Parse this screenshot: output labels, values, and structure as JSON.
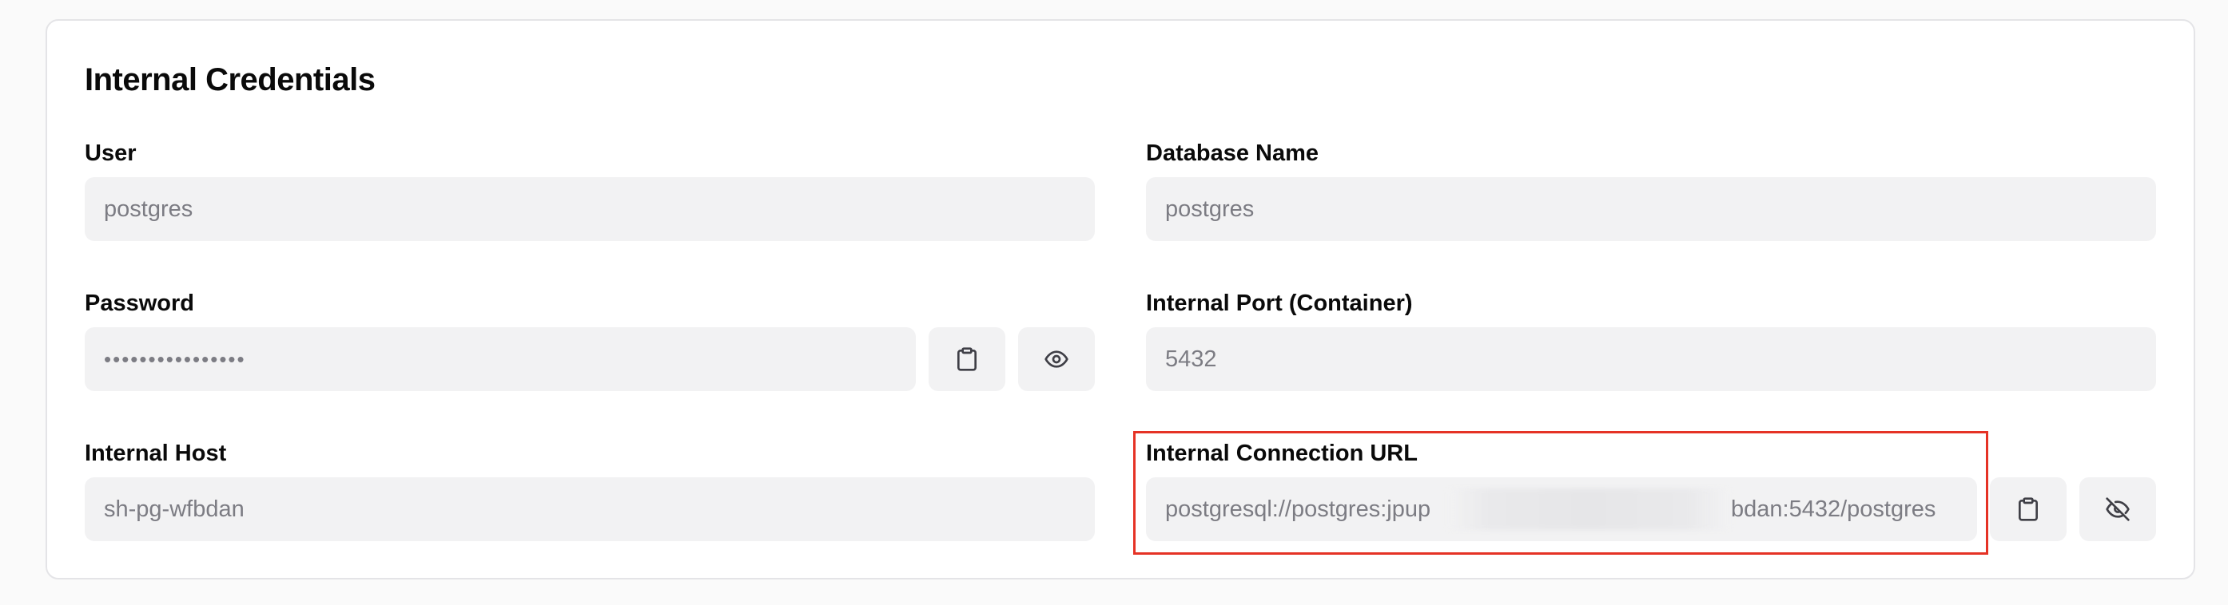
{
  "section": {
    "title": "Internal Credentials"
  },
  "fields": {
    "user": {
      "label": "User",
      "value": "postgres"
    },
    "database_name": {
      "label": "Database Name",
      "value": "postgres"
    },
    "password": {
      "label": "Password",
      "value": "••••••••••••••••"
    },
    "internal_port": {
      "label": "Internal Port (Container)",
      "value": "5432"
    },
    "internal_host": {
      "label": "Internal Host",
      "value": "sh-pg-wfbdan"
    },
    "connection_url": {
      "label": "Internal Connection URL",
      "value": "postgresql://postgres:jpup",
      "value_tail": "bdan:5432/postgres"
    }
  },
  "icons": {
    "copy": "clipboard-icon",
    "show": "eye-icon",
    "hide": "eye-off-icon"
  },
  "colors": {
    "highlight": "#e53225",
    "input_bg": "#f2f2f3"
  }
}
